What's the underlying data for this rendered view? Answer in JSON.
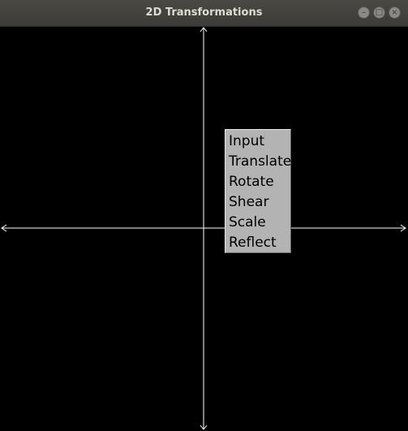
{
  "window": {
    "title": "2D Transformations",
    "buttons": [
      {
        "name": "minimize",
        "glyph": "–"
      },
      {
        "name": "maximize",
        "glyph": "□"
      },
      {
        "name": "close",
        "glyph": "×"
      }
    ]
  },
  "canvas": {
    "background": "#000000",
    "axis_color": "#ffffff"
  },
  "context_menu": {
    "items": [
      {
        "label": "Input"
      },
      {
        "label": "Translate"
      },
      {
        "label": "Rotate"
      },
      {
        "label": "Shear"
      },
      {
        "label": "Scale"
      },
      {
        "label": "Reflect"
      }
    ]
  }
}
